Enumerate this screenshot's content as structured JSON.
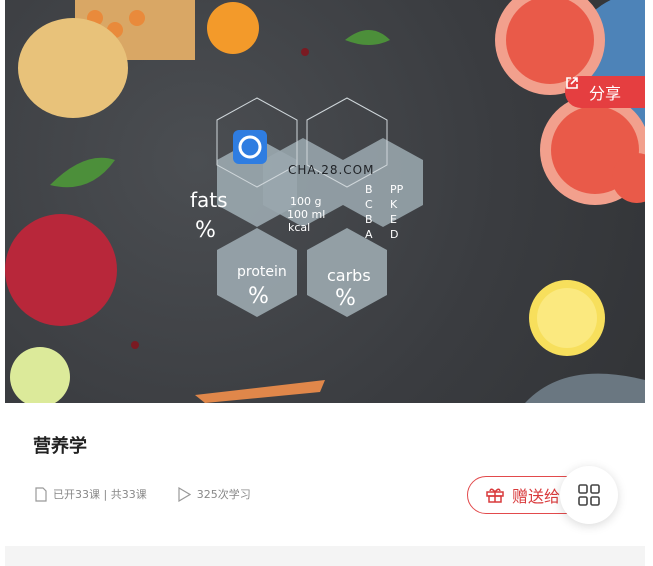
{
  "course": {
    "title": "营养学",
    "lessons_text": "已开33课 | 共33课",
    "views_text": "325次学习"
  },
  "share": {
    "label": "分享"
  },
  "gift": {
    "label": "赠送给"
  },
  "cover": {
    "nutrition_labels": {
      "fats": "fats",
      "protein": "protein",
      "carbs": "carbs",
      "percent": "%",
      "info": [
        "100 g",
        "100 ml",
        "kcal"
      ],
      "vitamins": [
        "B",
        "C",
        "B",
        "A"
      ],
      "minerals": [
        "PP",
        "K",
        "E",
        "D"
      ]
    },
    "watermark": "CHA.28.COM"
  },
  "colors": {
    "accent": "#e53e40",
    "hex_fill": "#9aa7ae"
  },
  "icons": {
    "share": "share-external-icon",
    "lessons": "document-icon",
    "views": "play-icon",
    "gift": "gift-icon",
    "menu": "grid-menu-icon"
  }
}
